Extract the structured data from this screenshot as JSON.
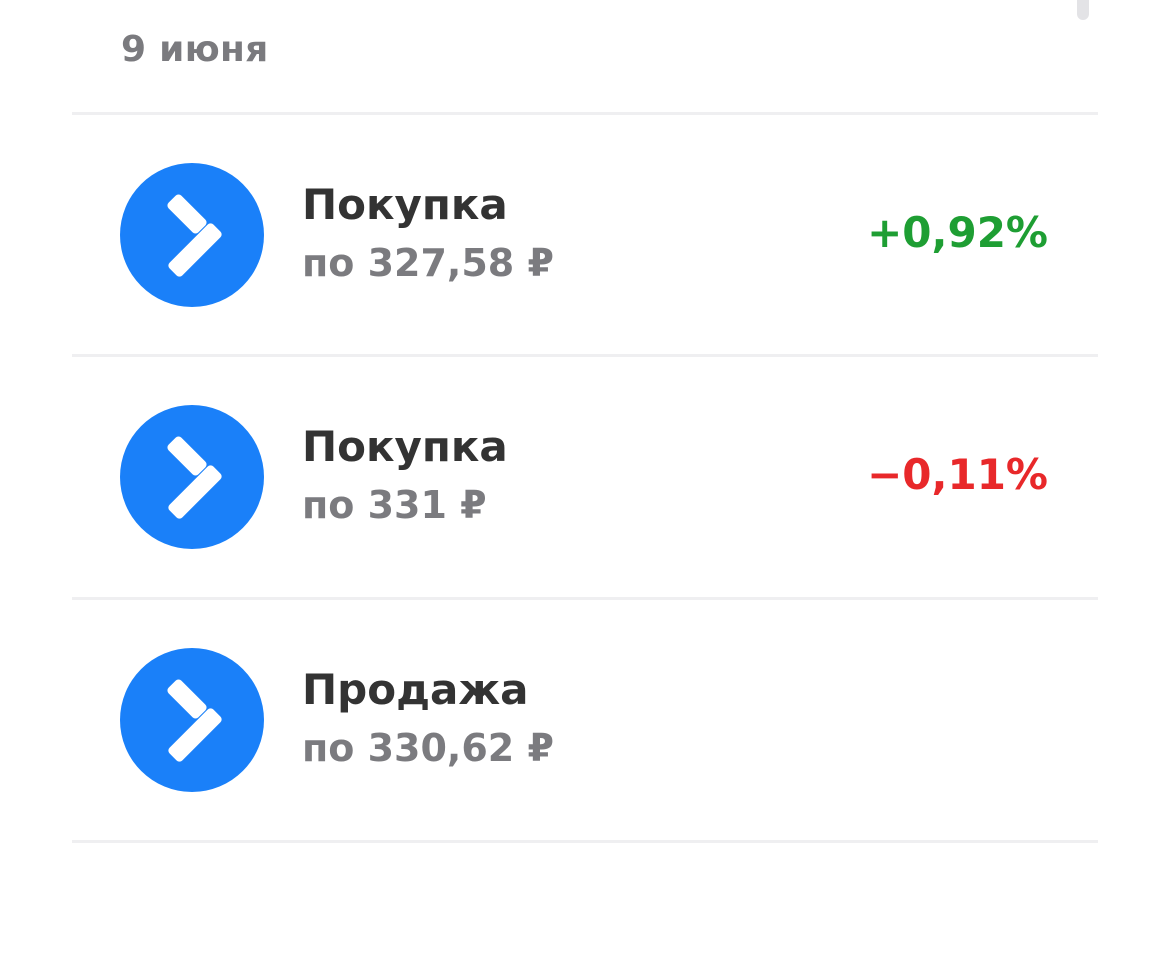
{
  "section": {
    "date": "9 июня"
  },
  "colors": {
    "icon_background": "#1a80f9",
    "positive": "#1e9e33",
    "negative": "#e8282a"
  },
  "operations": [
    {
      "type": "Покупка",
      "price": "по 327,58 ₽",
      "change": "+0,92%",
      "change_sign": "positive",
      "icon": "tinkoff-investments-arrow-icon"
    },
    {
      "type": "Покупка",
      "price": "по 331 ₽",
      "change": "−0,11%",
      "change_sign": "negative",
      "icon": "tinkoff-investments-arrow-icon"
    },
    {
      "type": "Продажа",
      "price": "по 330,62 ₽",
      "change": "",
      "change_sign": "none",
      "icon": "tinkoff-investments-arrow-icon"
    }
  ]
}
